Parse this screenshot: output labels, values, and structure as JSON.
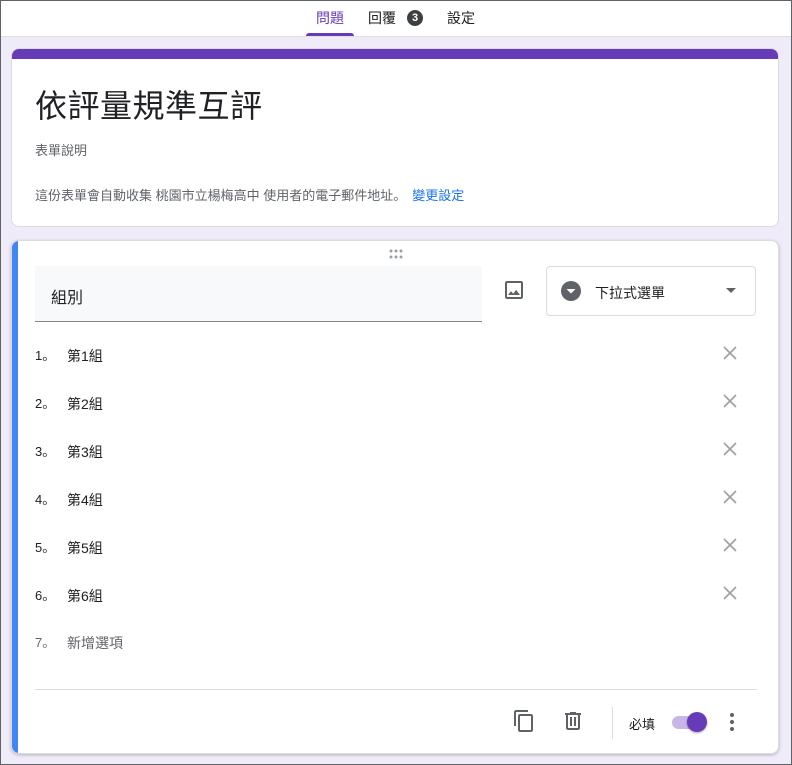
{
  "tabs": {
    "questions": "問題",
    "responses": "回覆",
    "responses_count": "3",
    "settings": "設定"
  },
  "form": {
    "title": "依評量規準互評",
    "description": "表單說明",
    "email_note": "這份表單會自動收集 桃園市立楊梅高中 使用者的電子郵件地址。",
    "email_link": "變更設定"
  },
  "question": {
    "title": "組別",
    "type_label": "下拉式選單",
    "options": [
      {
        "num": "1。",
        "label": "第1組"
      },
      {
        "num": "2。",
        "label": "第2組"
      },
      {
        "num": "3。",
        "label": "第3組"
      },
      {
        "num": "4。",
        "label": "第4組"
      },
      {
        "num": "5。",
        "label": "第5組"
      },
      {
        "num": "6。",
        "label": "第6組"
      }
    ],
    "add_option": {
      "num": "7。",
      "label": "新增選項"
    },
    "required_label": "必填",
    "required_on": true
  },
  "colors": {
    "accent": "#673ab7",
    "active_question": "#4285f4",
    "link": "#1a73e8"
  }
}
